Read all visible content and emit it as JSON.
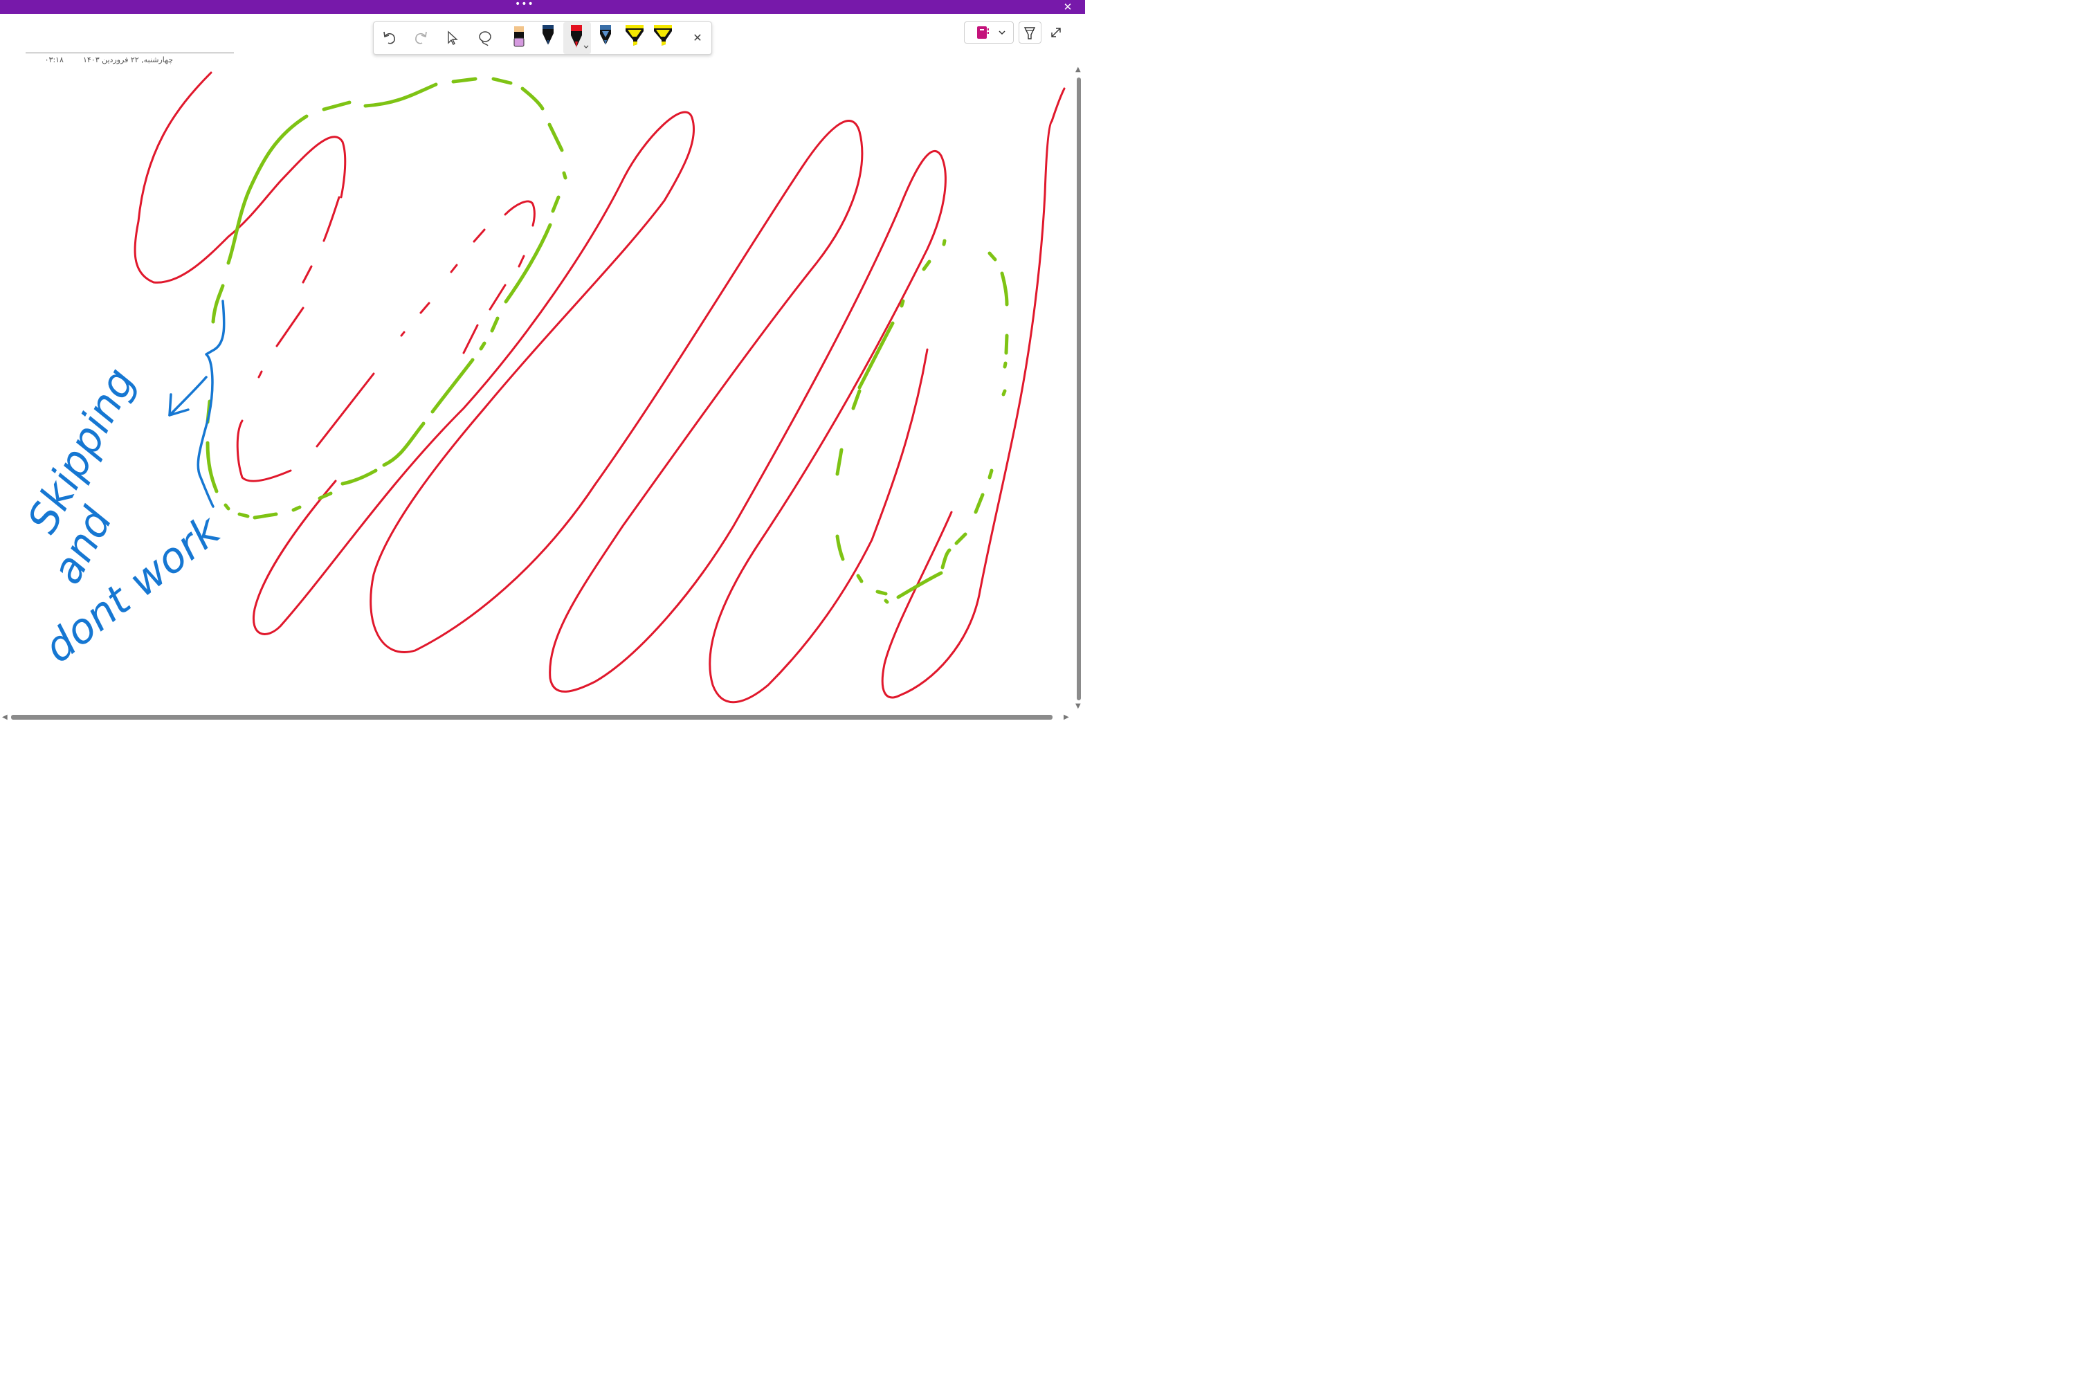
{
  "title_bar": {
    "more_label": "•••",
    "close_label": "✕"
  },
  "toolbar": {
    "tools": [
      {
        "name": "undo",
        "icon": "undo-icon"
      },
      {
        "name": "redo",
        "icon": "redo-icon"
      },
      {
        "name": "select",
        "icon": "cursor-icon"
      },
      {
        "name": "lasso",
        "icon": "lasso-icon"
      },
      {
        "name": "eraser",
        "icon": "eraser-icon"
      },
      {
        "name": "pen-dark-blue",
        "icon": "pen-icon",
        "color": "#1a3f6e"
      },
      {
        "name": "pen-red",
        "icon": "pen-icon",
        "color": "#e3101f",
        "selected": true
      },
      {
        "name": "pen-galaxy",
        "icon": "pen-icon",
        "color": "#3a6fa8"
      },
      {
        "name": "highlighter-yellow-1",
        "icon": "highlighter-icon",
        "color": "#f5e800"
      },
      {
        "name": "highlighter-yellow-2",
        "icon": "highlighter-icon",
        "color": "#f5e800"
      }
    ],
    "close_label": "✕"
  },
  "right_controls": {
    "notebook_icon": "notebook-icon",
    "notebook_color": "#c4127b",
    "pen_settings_icon": "pen-settings-icon",
    "expand_icon": "expand-icon"
  },
  "page_header": {
    "date": "چهارشنبه, ۲۲ فروردین ۱۴۰۳",
    "time": "۰۳:۱۸"
  },
  "handwriting": {
    "line1": "Skipping",
    "line2": "and",
    "line3": "dont work"
  },
  "ink_colors": {
    "red": "#e0182c",
    "green": "#7ec314",
    "blue": "#1677d2"
  },
  "scrollbars": {
    "up": "▲",
    "down": "▼",
    "left": "◀",
    "right": "▶"
  },
  "accent": "#7719aa"
}
